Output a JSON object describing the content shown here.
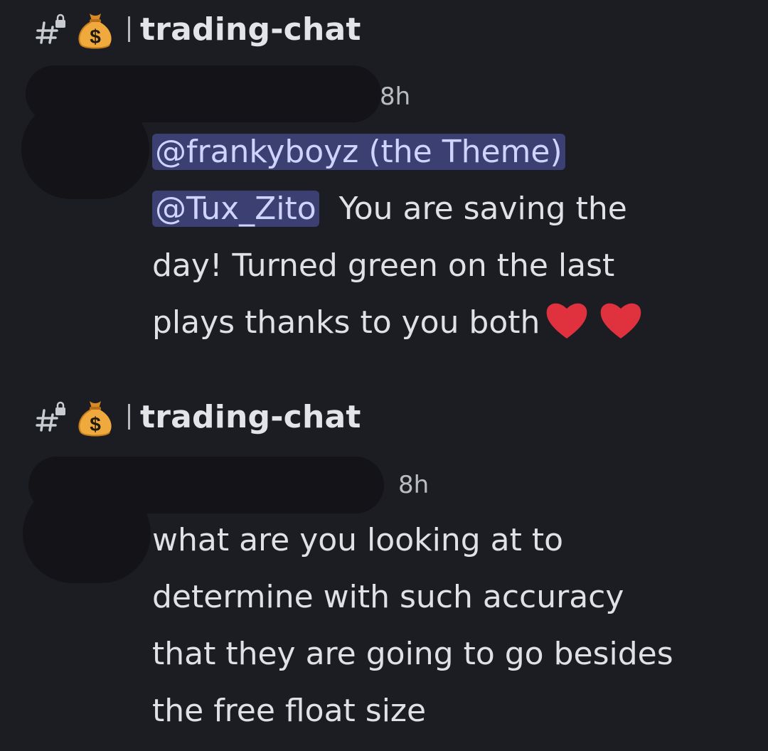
{
  "messages": [
    {
      "channel": "trading-chat",
      "timestamp": "8h",
      "mentions": [
        "@frankyboyz (the Theme)",
        "@Tux_Zito"
      ],
      "text_after_mentions": "You are saving the",
      "text_line3": "day! Turned green on the last",
      "text_line4": "plays thanks to you both",
      "reactions_inline": [
        "heart",
        "heart"
      ]
    },
    {
      "channel": "trading-chat",
      "timestamp": "8h",
      "lines": [
        "what are you looking at to",
        "determine with such accuracy",
        "that they are going to go besides",
        "the free float size"
      ]
    }
  ],
  "icons": {
    "channel_type": "locked-hash-icon",
    "channel_emoji": "money-bag-icon",
    "reaction": "red-heart-icon"
  },
  "colors": {
    "background": "#1c1d22",
    "mention_bg": "#3b3f72",
    "heart": "#e0313f",
    "money_bag": "#e9a23b"
  }
}
